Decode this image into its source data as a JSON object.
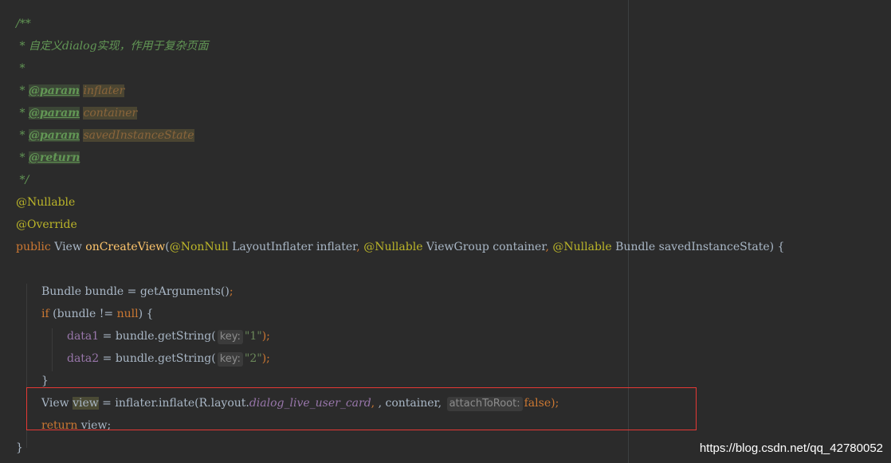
{
  "code": {
    "doc_open": "/**",
    "doc_desc": " * 自定义dialog实现，作用于复杂页面",
    "doc_blank": " *",
    "star": " * ",
    "doc_params": [
      {
        "tag": "@param",
        "name": "inflater"
      },
      {
        "tag": "@param",
        "name": "container"
      },
      {
        "tag": "@param",
        "name": "savedInstanceState"
      }
    ],
    "doc_return": "@return",
    "doc_close": " */",
    "annot_nullable": "@Nullable",
    "annot_override": "@Override",
    "sig": {
      "public": "public",
      "view_type": " View ",
      "method": "onCreateView",
      "paren_open": "(",
      "nonnull": "@NonNull",
      "p1": " LayoutInflater inflater",
      "comma": ", ",
      "nullable1": "@Nullable",
      "p2": " ViewGroup container",
      "nullable2": "@Nullable",
      "p3": " Bundle savedInstanceState) {"
    },
    "bundle_line": "Bundle bundle = getArguments()",
    "semicolon": ";",
    "if_kw": "if",
    "if_cond_a": " (bundle != ",
    "null_kw": "null",
    "if_cond_b": ") {",
    "data1": "data1",
    "data2": "data2",
    "assign_getstring": " = bundle.getString(",
    "hint_key": "key:",
    "str1": "\"1\"",
    "str2": "\"2\"",
    "close_paren_semicolon": ");",
    "close_brace": "}",
    "view_type2": "View ",
    "view_var": "view",
    "inflate_a": " = inflater.inflate(R.layout.",
    "layout_name": "dialog_live_user_card",
    "inflate_b": ", container, ",
    "hint_attach": "attachToRoot:",
    "false_kw": "false",
    "inflate_c": ");",
    "return_kw": "return",
    "return_rest": " view;",
    "final_brace": "}"
  },
  "watermark": "https://blog.csdn.net/qq_42780052",
  "colors": {
    "background": "#2b2b2b",
    "highlight_box": "#e53935"
  }
}
